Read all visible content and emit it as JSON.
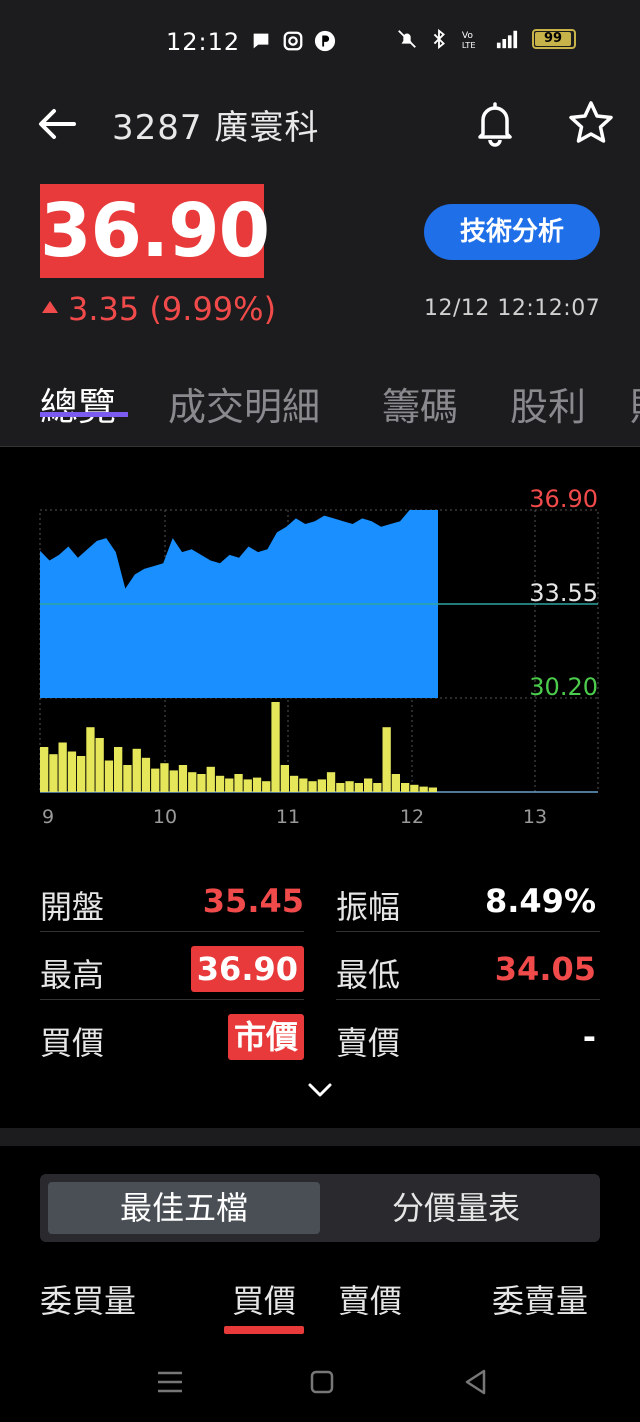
{
  "status": {
    "time": "12:12",
    "battery": "99",
    "network": "4G"
  },
  "header": {
    "title": "3287 廣寰科"
  },
  "quote": {
    "price": "36.90",
    "change": "3.35 (9.99%)",
    "timestamp": "12/12 12:12:07",
    "tech_button": "技術分析"
  },
  "tabs": [
    "總覽",
    "成交明細",
    "籌碼",
    "股利",
    "財"
  ],
  "chart_data": {
    "type": "area",
    "title": "",
    "y_high_label": "36.90",
    "y_mid_label": "33.55",
    "y_low_label": "30.20",
    "ylim": [
      30.2,
      36.9
    ],
    "reference_price": 33.55,
    "x_ticks": [
      "9",
      "10",
      "11",
      "12",
      "13"
    ],
    "price_series": [
      35.45,
      35.1,
      35.3,
      35.6,
      35.2,
      35.5,
      35.8,
      35.9,
      35.4,
      34.1,
      34.6,
      34.8,
      34.9,
      35.0,
      35.9,
      35.4,
      35.5,
      35.3,
      35.1,
      35.0,
      35.3,
      35.2,
      35.6,
      35.4,
      35.5,
      36.1,
      36.3,
      36.6,
      36.4,
      36.5,
      36.7,
      36.6,
      36.5,
      36.4,
      36.6,
      36.5,
      36.3,
      36.4,
      36.5,
      36.9,
      36.9,
      36.9,
      36.9
    ],
    "volume_series": [
      0.5,
      0.42,
      0.55,
      0.45,
      0.4,
      0.72,
      0.6,
      0.35,
      0.5,
      0.3,
      0.48,
      0.38,
      0.26,
      0.32,
      0.24,
      0.3,
      0.22,
      0.2,
      0.28,
      0.18,
      0.15,
      0.2,
      0.14,
      0.16,
      0.12,
      1.0,
      0.3,
      0.18,
      0.15,
      0.12,
      0.14,
      0.22,
      0.1,
      0.12,
      0.1,
      0.15,
      0.1,
      0.72,
      0.2,
      0.1,
      0.08,
      0.06,
      0.05
    ]
  },
  "stats": {
    "open_label": "開盤",
    "open_value": "35.45",
    "amp_label": "振幅",
    "amp_value": "8.49%",
    "high_label": "最高",
    "high_value": "36.90",
    "low_label": "最低",
    "low_value": "34.05",
    "bid_label": "買價",
    "bid_value": "市價",
    "ask_label": "賣價",
    "ask_value": "-"
  },
  "orderbook": {
    "seg_best5": "最佳五檔",
    "seg_price_volume": "分價量表",
    "col_bid_qty": "委買量",
    "col_bid_price": "買價",
    "col_ask_price": "賣價",
    "col_ask_qty": "委賣量"
  },
  "colors": {
    "up": "#f04a4a",
    "down": "#4ccc4c",
    "area": "#1a8fff",
    "volume": "#e6e65a",
    "accent": "#7c5cf0"
  }
}
